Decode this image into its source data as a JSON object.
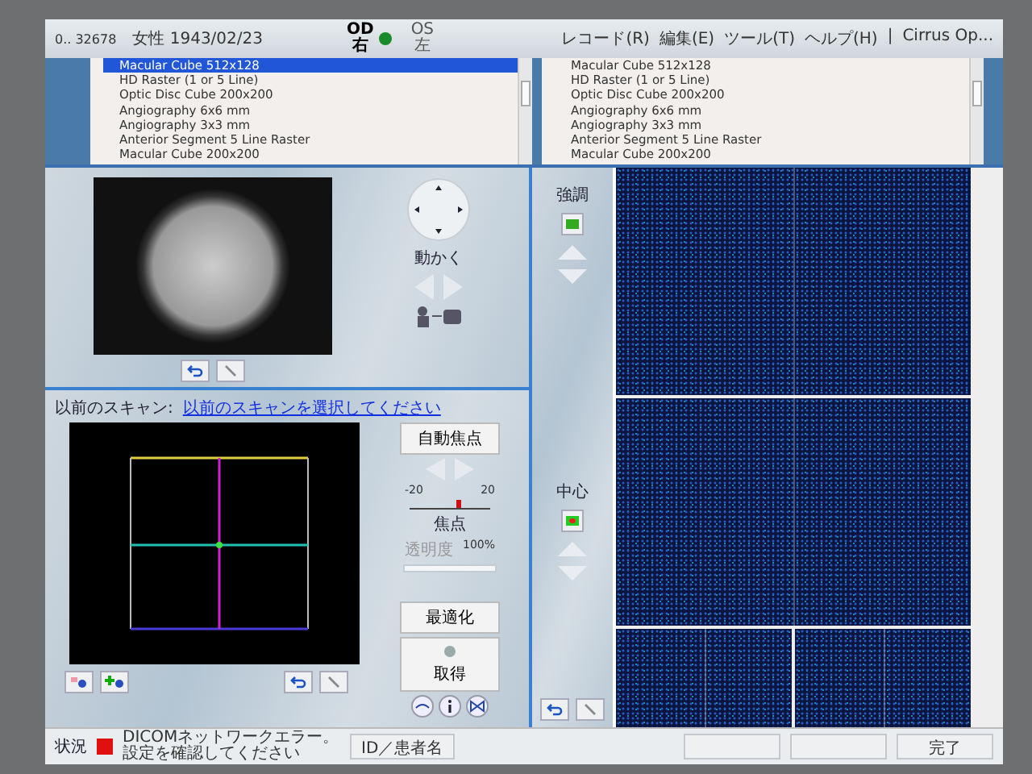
{
  "header": {
    "patient_id": "0.. 32678",
    "patient_info": "女性 1943/02/23",
    "eyes": [
      {
        "code": "OD",
        "side": "右",
        "selected": true
      },
      {
        "code": "OS",
        "side": "左",
        "selected": false
      }
    ],
    "menu": [
      "レコード(R)",
      "編集(E)",
      "ツール(T)",
      "ヘルプ(H)",
      "|",
      "Cirrus Op..."
    ]
  },
  "scan_lists": [
    {
      "items": [
        {
          "label": "Macular Cube 512x128",
          "selected": true
        },
        {
          "label": "HD Raster (1 or 5 Line)",
          "selected": false
        },
        {
          "label": "Optic Disc Cube 200x200",
          "selected": false
        },
        {
          "label": "Angiography 6x6 mm",
          "selected": false
        },
        {
          "label": "Angiography 3x3 mm",
          "selected": false
        },
        {
          "label": "Anterior Segment 5 Line Raster",
          "selected": false
        },
        {
          "label": "Macular Cube 200x200",
          "selected": false
        }
      ]
    },
    {
      "items": [
        {
          "label": "Macular Cube 512x128",
          "selected": false
        },
        {
          "label": "HD Raster (1 or 5 Line)",
          "selected": false
        },
        {
          "label": "Optic Disc Cube 200x200",
          "selected": false
        },
        {
          "label": "Angiography 6x6 mm",
          "selected": false
        },
        {
          "label": "Angiography 3x3 mm",
          "selected": false
        },
        {
          "label": "Anterior Segment 5 Line Raster",
          "selected": false
        },
        {
          "label": "Macular Cube 200x200",
          "selected": false
        }
      ]
    }
  ],
  "iris_panel": {
    "move_label": "動かく"
  },
  "previous_scan": {
    "label": "以前のスキャン:",
    "link": "以前のスキャンを選択してください"
  },
  "controls": {
    "autofocus": "自動焦点",
    "focus": {
      "min": "-20",
      "max": "20",
      "label": "焦点",
      "level": 0.6
    },
    "transparency": {
      "label": "透明度",
      "reading": "100%",
      "level": 1.0
    },
    "optimize": "最適化",
    "capture": "取得"
  },
  "adjust": [
    {
      "label": "強調"
    },
    {
      "label": "中心"
    }
  ],
  "status": {
    "label": "状況",
    "error": true,
    "message": "DICOMネットワークエラー。設定を確認してください"
  },
  "footer_buttons": [
    {
      "label": "ID／患者名"
    },
    {
      "label": "完了"
    }
  ]
}
